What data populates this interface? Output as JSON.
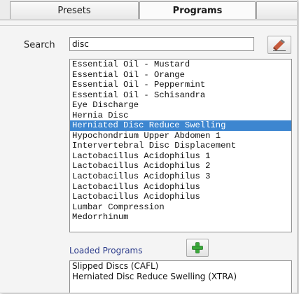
{
  "tabs": [
    {
      "label": "Presets",
      "active": false
    },
    {
      "label": "Programs",
      "active": true
    }
  ],
  "search": {
    "label": "Search",
    "value": "disc",
    "clear_icon": "eraser-icon"
  },
  "program_list": {
    "items": [
      "Essential Oil - Mustard",
      "Essential Oil - Orange",
      "Essential Oil - Peppermint",
      "Essential Oil - Schisandra",
      "Eye Discharge",
      "Hernia Disc",
      "Herniated Disc Reduce Swelling",
      "Hypochondrium Upper Abdomen 1",
      "Intervertebral Disc Displacement",
      "Lactobacillus Acidophilus 1",
      "Lactobacillus Acidophilus 2",
      "Lactobacillus Acidophilus 3",
      "Lactobacillus Acidophilus",
      "Lactobacillus Acidophilus",
      "Lumbar Compression",
      "Medorrhinum"
    ],
    "selected_index": 6,
    "selection_color": "#3d86d0"
  },
  "loaded_programs": {
    "label": "Loaded Programs",
    "add_icon": "plus-icon",
    "add_color": "#3aa83a",
    "items": [
      "Slipped Discs (CAFL)",
      "Herniated Disc Reduce Swelling (XTRA)"
    ]
  }
}
